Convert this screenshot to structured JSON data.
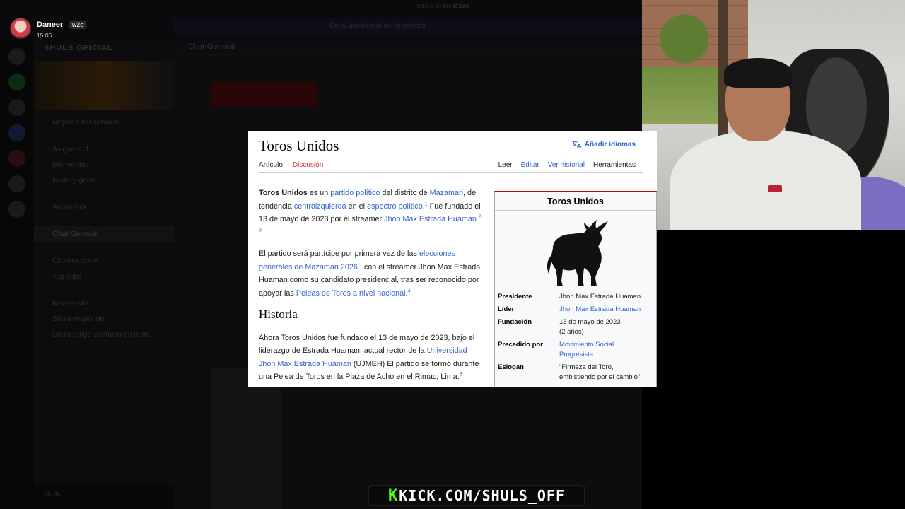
{
  "stream": {
    "streamer_name": "Daneer",
    "streamer_badge": "w2e",
    "stream_time": "15:06",
    "kick_url": "KICK.COM/SHULS_OFF",
    "kick_accent": "#53fc18"
  },
  "discord": {
    "server_name": "SHULS OFICIAL",
    "channel_title": "Chat-General",
    "top_notice": "Canal gestionado por el servidor",
    "channels": [
      "Mejoras del servidor",
      "Asignar-rol",
      "Bienvenida",
      "Invita-y-gana",
      "Aviso-Kick",
      "Chat-General",
      "Clipersx-zone",
      "Top-clips",
      "Io-ve-shuls",
      "Shuls-responde"
    ],
    "user": "shuls",
    "last_message": "Shuls tengo contacto en la m..."
  },
  "wiki": {
    "title": "Toros Unidos",
    "add_languages": "Añadir idiomas",
    "tabs_left": [
      "Artículo",
      "Discusión"
    ],
    "tabs_right": [
      "Leer",
      "Editar",
      "Ver historial",
      "Herramientas"
    ],
    "p1": {
      "bold": "Toros Unidos",
      "t1": " es un ",
      "l1": "partido político",
      "t2": " del distrito de ",
      "l2": "Mazamari",
      "t3": ", de tendencia ",
      "l3": "centroizquierda",
      "t4": " en el ",
      "l4": "espectro político",
      "s1": "1",
      "t5": "  Fue fundado el 13 de mayo de 2023 por el streamer ",
      "l5": "Jhon Max Estrada Huaman",
      "s2": "2",
      "s3": "3"
    },
    "p2": {
      "t1": "El partido será partícipe por primera vez de las ",
      "l1": "elecciones generales de Mazamari 2026",
      "t2": " , con el streamer Jhon Max Estrada Huaman como su candidato presidencial, tras ser reconocido por apoyar las ",
      "l2": "Peleas de Toros a nivel nacional",
      "s1": "4"
    },
    "history_heading": "Historia",
    "p3": {
      "t1": "Ahora Toros Unidos fue fundado el 13 de mayo de 2023, bajo el liderazgo de Estrada Huaman, actual rector de la ",
      "l1": "Universidad Jhon Max Estrada Huaman",
      "t2": " (UJMEH) El partido se formó durante una Pelea de Toros en la Plaza de Acho en el Rimac, Lima.",
      "s1": "5"
    },
    "infobox": {
      "title": "Toros Unidos",
      "rows": [
        {
          "label": "Presidente",
          "value": "Jhon Max Estrada Huaman",
          "link": false
        },
        {
          "label": "Líder",
          "value": "Jhon Max Estrada Huaman",
          "link": true
        },
        {
          "label": "Fundación",
          "value": "13 de mayo de 2023",
          "value2": "(2 años)",
          "link": false
        },
        {
          "label": "Precedido por",
          "value": "Movimiento Social",
          "value2": "Progresista",
          "link": true
        },
        {
          "label": "Eslogan",
          "value": "\"Firmeza del Toro,",
          "value2": "embistiendo por el cambio\"",
          "link": false
        }
      ]
    }
  }
}
